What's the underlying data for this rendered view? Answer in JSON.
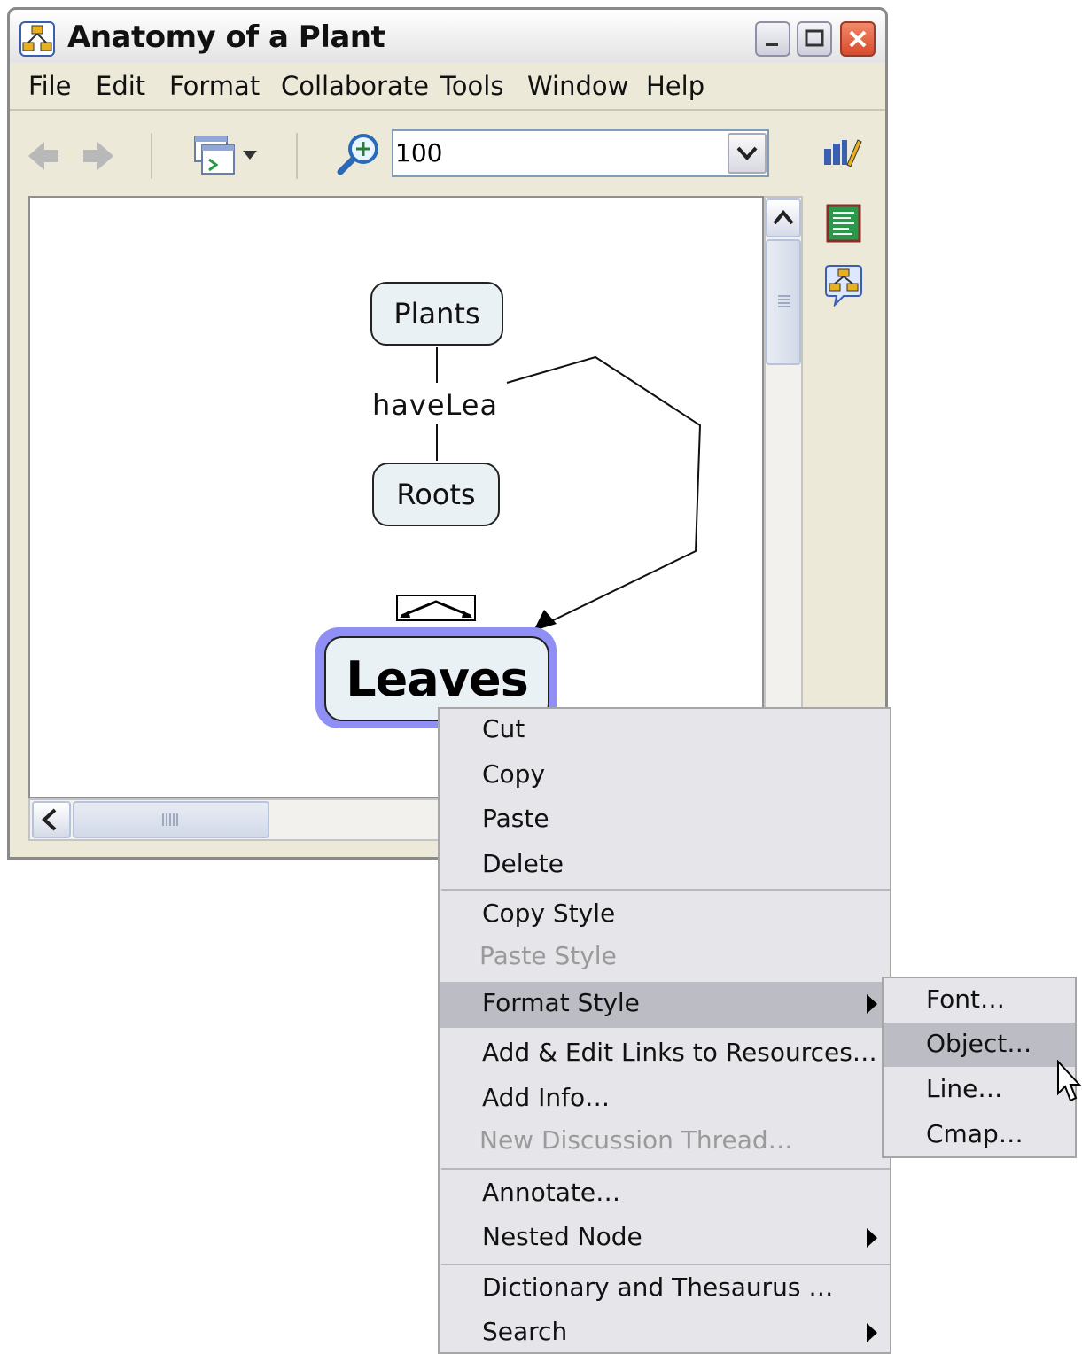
{
  "window": {
    "title": "Anatomy of a Plant"
  },
  "menubar": {
    "items": [
      "File",
      "Edit",
      "Format",
      "Collaborate",
      "Tools",
      "Window",
      "Help"
    ]
  },
  "toolbar": {
    "zoom_value": "100"
  },
  "map": {
    "nodes": {
      "plants": "Plants",
      "roots": "Roots",
      "leaves": "Leaves"
    },
    "link_label": "haveLea"
  },
  "context_menu": {
    "cut": "Cut",
    "copy": "Copy",
    "paste": "Paste",
    "delete": "Delete",
    "copy_style": "Copy Style",
    "paste_style": "Paste Style",
    "format_style": "Format Style",
    "add_links": "Add & Edit Links to Resources…",
    "add_info": "Add Info…",
    "new_discussion": "New Discussion Thread…",
    "annotate": "Annotate…",
    "nested_node": "Nested Node",
    "dictionary": "Dictionary and Thesaurus …",
    "search": "Search"
  },
  "submenu": {
    "font": "Font…",
    "object": "Object…",
    "line": "Line…",
    "cmap": "Cmap…"
  },
  "colors": {
    "selection_halo": "#8f8ff5",
    "node_fill": "#eaf1f4",
    "menu_highlight": "#bcbcc4"
  }
}
